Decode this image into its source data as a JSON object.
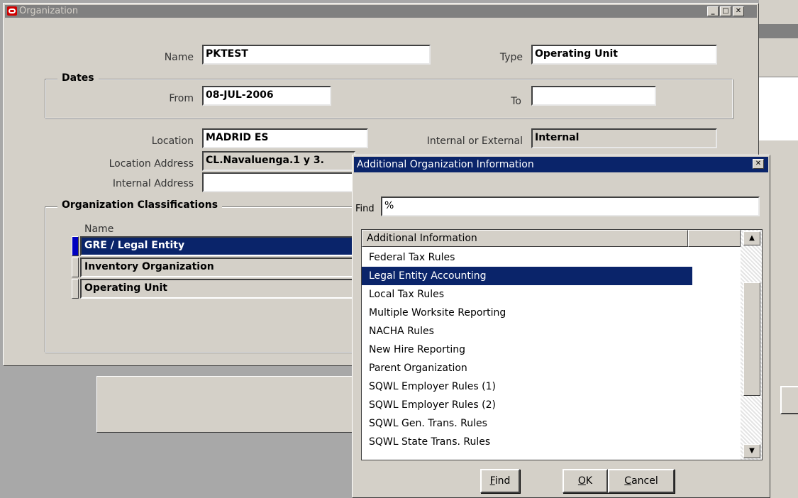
{
  "background_window": {
    "right_panel_color": "#ffffff"
  },
  "org_window": {
    "title": "Organization",
    "title_icon": "oracle-logo-icon",
    "window_buttons": [
      "minimize-icon",
      "maximize-icon",
      "close-icon"
    ],
    "name_label": "Name",
    "name_value": "PKTEST",
    "type_label": "Type",
    "type_value": "Operating Unit",
    "dates_group": "Dates",
    "from_label": "From",
    "from_value": "08-JUL-2006",
    "to_label": "To",
    "to_value": "",
    "location_label": "Location",
    "location_value": "MADRID ES",
    "int_ext_label": "Internal or External",
    "int_ext_value": "Internal",
    "location_address_label": "Location Address",
    "location_address_value": "CL.Navaluenga.1 y 3.",
    "internal_address_label": "Internal Address",
    "internal_address_value": "",
    "classifications_group": "Organization Classifications",
    "classifications_name_header": "Name",
    "classifications": [
      "GRE / Legal Entity",
      "Inventory Organization",
      "Operating Unit"
    ]
  },
  "dialog": {
    "title": "Additional Organization Information",
    "find_label": "Find",
    "find_value": "%",
    "column_header": "Additional Information",
    "items": [
      "Federal Tax Rules",
      "Legal Entity Accounting",
      "Local Tax Rules",
      "Multiple Worksite Reporting",
      "NACHA Rules",
      "New Hire Reporting",
      "Parent Organization",
      "SQWL Employer Rules (1)",
      "SQWL Employer Rules (2)",
      "SQWL Gen. Trans. Rules",
      "SQWL State Trans. Rules"
    ],
    "selected_item": "Legal Entity Accounting",
    "find_button": {
      "mnemonic": "F",
      "rest": "ind"
    },
    "ok_button": {
      "mnemonic": "O",
      "rest": "K"
    },
    "cancel_button": {
      "mnemonic": "C",
      "rest": "ancel"
    }
  },
  "colors": {
    "active_title": "#0a246a",
    "inactive_title": "#808080",
    "face": "#d4d0c8",
    "selection": "#0a246a"
  }
}
